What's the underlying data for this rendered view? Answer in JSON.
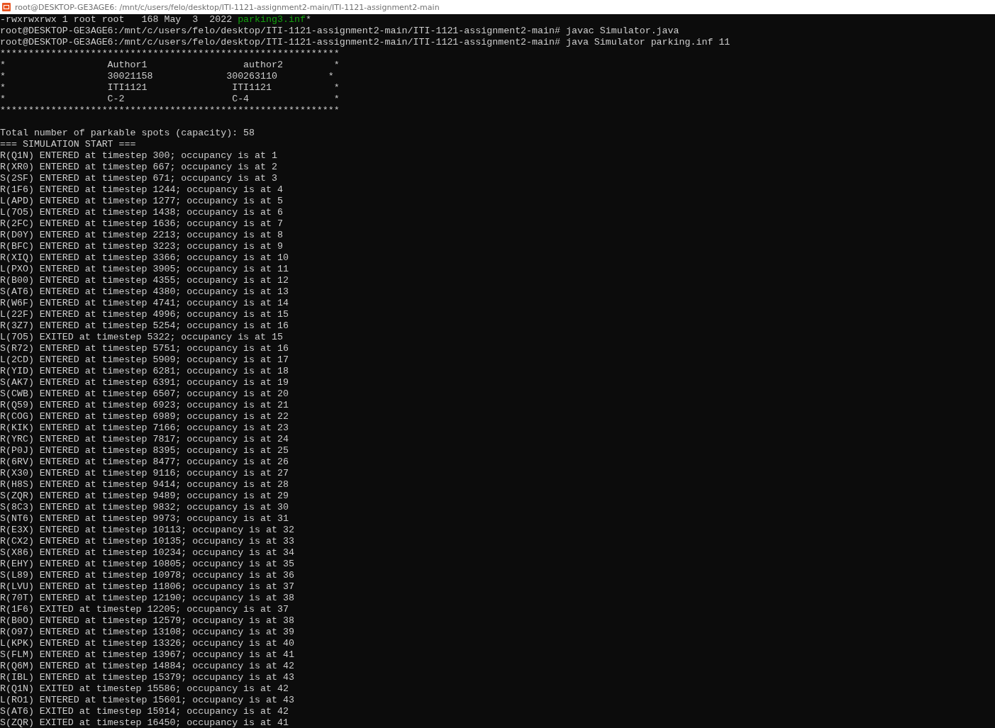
{
  "window": {
    "title": "root@DESKTOP-GE3AGE6: /mnt/c/users/felo/desktop/ITI-1121-assignment2-main/ITI-1121-assignment2-main"
  },
  "lines": [
    {
      "kind": "listing",
      "text": "-rwxrwxrwx 1 root root   168 May  3  2022 ",
      "file": "parking3.inf",
      "suffix": "*"
    },
    {
      "kind": "text",
      "text": "root@DESKTOP-GE3AGE6:/mnt/c/users/felo/desktop/ITI-1121-assignment2-main/ITI-1121-assignment2-main# javac Simulator.java"
    },
    {
      "kind": "text",
      "text": "root@DESKTOP-GE3AGE6:/mnt/c/users/felo/desktop/ITI-1121-assignment2-main/ITI-1121-assignment2-main# java Simulator parking.inf 11"
    },
    {
      "kind": "text",
      "text": "************************************************************"
    },
    {
      "kind": "text",
      "text": "*                  Author1                 author2         *"
    },
    {
      "kind": "text",
      "text": "*                  30021158             300263110         *"
    },
    {
      "kind": "text",
      "text": "*                  ITI1121               ITI1121           *"
    },
    {
      "kind": "text",
      "text": "*                  C-2                   C-4               *"
    },
    {
      "kind": "text",
      "text": "************************************************************"
    },
    {
      "kind": "blank"
    },
    {
      "kind": "text",
      "text": "Total number of parkable spots (capacity): 58"
    },
    {
      "kind": "text",
      "text": "=== SIMULATION START ==="
    },
    {
      "kind": "text",
      "text": "R(Q1N) ENTERED at timestep 300; occupancy is at 1"
    },
    {
      "kind": "text",
      "text": "R(XR0) ENTERED at timestep 667; occupancy is at 2"
    },
    {
      "kind": "text",
      "text": "S(2SF) ENTERED at timestep 671; occupancy is at 3"
    },
    {
      "kind": "text",
      "text": "R(1F6) ENTERED at timestep 1244; occupancy is at 4"
    },
    {
      "kind": "text",
      "text": "L(APD) ENTERED at timestep 1277; occupancy is at 5"
    },
    {
      "kind": "text",
      "text": "L(7O5) ENTERED at timestep 1438; occupancy is at 6"
    },
    {
      "kind": "text",
      "text": "R(2FC) ENTERED at timestep 1636; occupancy is at 7"
    },
    {
      "kind": "text",
      "text": "R(D0Y) ENTERED at timestep 2213; occupancy is at 8"
    },
    {
      "kind": "text",
      "text": "R(BFC) ENTERED at timestep 3223; occupancy is at 9"
    },
    {
      "kind": "text",
      "text": "R(XIQ) ENTERED at timestep 3366; occupancy is at 10"
    },
    {
      "kind": "text",
      "text": "L(PXO) ENTERED at timestep 3905; occupancy is at 11"
    },
    {
      "kind": "text",
      "text": "R(B00) ENTERED at timestep 4355; occupancy is at 12"
    },
    {
      "kind": "text",
      "text": "S(AT6) ENTERED at timestep 4380; occupancy is at 13"
    },
    {
      "kind": "text",
      "text": "R(W6F) ENTERED at timestep 4741; occupancy is at 14"
    },
    {
      "kind": "text",
      "text": "L(22F) ENTERED at timestep 4996; occupancy is at 15"
    },
    {
      "kind": "text",
      "text": "R(3Z7) ENTERED at timestep 5254; occupancy is at 16"
    },
    {
      "kind": "text",
      "text": "L(7O5) EXITED at timestep 5322; occupancy is at 15"
    },
    {
      "kind": "text",
      "text": "S(R72) ENTERED at timestep 5751; occupancy is at 16"
    },
    {
      "kind": "text",
      "text": "L(2CD) ENTERED at timestep 5909; occupancy is at 17"
    },
    {
      "kind": "text",
      "text": "R(YID) ENTERED at timestep 6281; occupancy is at 18"
    },
    {
      "kind": "text",
      "text": "S(AK7) ENTERED at timestep 6391; occupancy is at 19"
    },
    {
      "kind": "text",
      "text": "S(CWB) ENTERED at timestep 6507; occupancy is at 20"
    },
    {
      "kind": "text",
      "text": "R(Q59) ENTERED at timestep 6923; occupancy is at 21"
    },
    {
      "kind": "text",
      "text": "R(COG) ENTERED at timestep 6989; occupancy is at 22"
    },
    {
      "kind": "text",
      "text": "R(KIK) ENTERED at timestep 7166; occupancy is at 23"
    },
    {
      "kind": "text",
      "text": "R(YRC) ENTERED at timestep 7817; occupancy is at 24"
    },
    {
      "kind": "text",
      "text": "R(P0J) ENTERED at timestep 8395; occupancy is at 25"
    },
    {
      "kind": "text",
      "text": "R(6RV) ENTERED at timestep 8477; occupancy is at 26"
    },
    {
      "kind": "text",
      "text": "R(X30) ENTERED at timestep 9116; occupancy is at 27"
    },
    {
      "kind": "text",
      "text": "R(H8S) ENTERED at timestep 9414; occupancy is at 28"
    },
    {
      "kind": "text",
      "text": "S(ZQR) ENTERED at timestep 9489; occupancy is at 29"
    },
    {
      "kind": "text",
      "text": "S(8C3) ENTERED at timestep 9832; occupancy is at 30"
    },
    {
      "kind": "text",
      "text": "S(NT6) ENTERED at timestep 9973; occupancy is at 31"
    },
    {
      "kind": "text",
      "text": "R(E3X) ENTERED at timestep 10113; occupancy is at 32"
    },
    {
      "kind": "text",
      "text": "R(CX2) ENTERED at timestep 10135; occupancy is at 33"
    },
    {
      "kind": "text",
      "text": "S(X86) ENTERED at timestep 10234; occupancy is at 34"
    },
    {
      "kind": "text",
      "text": "R(EHY) ENTERED at timestep 10805; occupancy is at 35"
    },
    {
      "kind": "text",
      "text": "S(L89) ENTERED at timestep 10978; occupancy is at 36"
    },
    {
      "kind": "text",
      "text": "R(LVU) ENTERED at timestep 11806; occupancy is at 37"
    },
    {
      "kind": "text",
      "text": "R(70T) ENTERED at timestep 12190; occupancy is at 38"
    },
    {
      "kind": "text",
      "text": "R(1F6) EXITED at timestep 12205; occupancy is at 37"
    },
    {
      "kind": "text",
      "text": "R(B0O) ENTERED at timestep 12579; occupancy is at 38"
    },
    {
      "kind": "text",
      "text": "R(O97) ENTERED at timestep 13108; occupancy is at 39"
    },
    {
      "kind": "text",
      "text": "L(KPK) ENTERED at timestep 13326; occupancy is at 40"
    },
    {
      "kind": "text",
      "text": "S(FLM) ENTERED at timestep 13967; occupancy is at 41"
    },
    {
      "kind": "text",
      "text": "R(Q6M) ENTERED at timestep 14884; occupancy is at 42"
    },
    {
      "kind": "text",
      "text": "R(IBL) ENTERED at timestep 15379; occupancy is at 43"
    },
    {
      "kind": "text",
      "text": "R(Q1N) EXITED at timestep 15586; occupancy is at 42"
    },
    {
      "kind": "text",
      "text": "L(RO1) ENTERED at timestep 15601; occupancy is at 43"
    },
    {
      "kind": "text",
      "text": "S(AT6) EXITED at timestep 15914; occupancy is at 42"
    },
    {
      "kind": "text",
      "text": "S(ZQR) EXITED at timestep 16450; occupancy is at 41"
    }
  ]
}
